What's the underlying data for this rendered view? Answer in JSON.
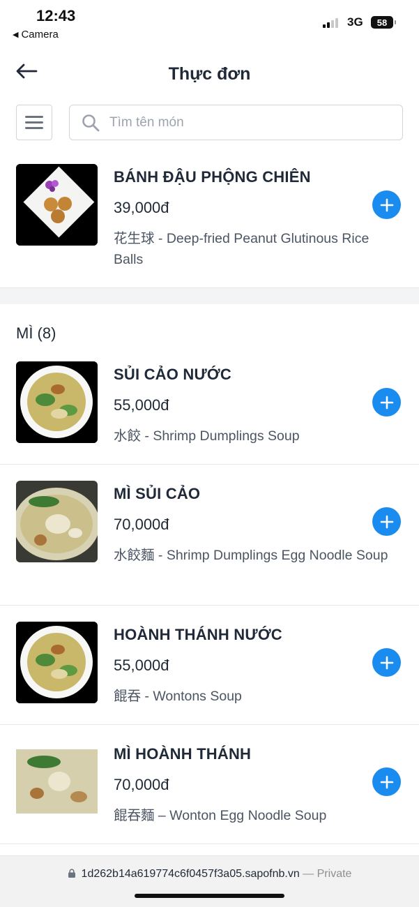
{
  "status_bar": {
    "time": "12:43",
    "back_app": "Camera",
    "network": "3G",
    "battery": "58"
  },
  "header": {
    "title": "Thực đơn"
  },
  "search": {
    "placeholder": "Tìm tên món",
    "value": ""
  },
  "top_item": {
    "name": "BÁNH ĐẬU PHỘNG CHIÊN",
    "price": "39,000đ",
    "description": "花生球 - Deep-fried Peanut Glutinous Rice Balls"
  },
  "category": {
    "title": "MÌ (8)",
    "items": [
      {
        "name": "SỦI CẢO NƯỚC",
        "price": "55,000đ",
        "description": "水餃 - Shrimp Dumplings Soup"
      },
      {
        "name": "MÌ SỦI CẢO",
        "price": "70,000đ",
        "description": "水餃麵 - Shrimp Dumplings Egg Noodle Soup"
      },
      {
        "name": "HOÀNH THÁNH NƯỚC",
        "price": "55,000đ",
        "description": "餛吞 - Wontons Soup"
      },
      {
        "name": "MÌ HOÀNH THÁNH",
        "price": "70,000đ",
        "description": "餛吞麵 – Wonton Egg Noodle Soup"
      }
    ]
  },
  "browser": {
    "url": "1d262b14a619774c6f0457f3a05.sapofnb.vn",
    "private_label": "— Private"
  },
  "colors": {
    "accent": "#1a8cf0",
    "text": "#1f2937",
    "muted": "#4b5563"
  },
  "icons": {
    "back": "arrow-left-icon",
    "menu": "hamburger-icon",
    "search": "search-icon",
    "add": "plus-icon",
    "lock": "lock-icon"
  }
}
